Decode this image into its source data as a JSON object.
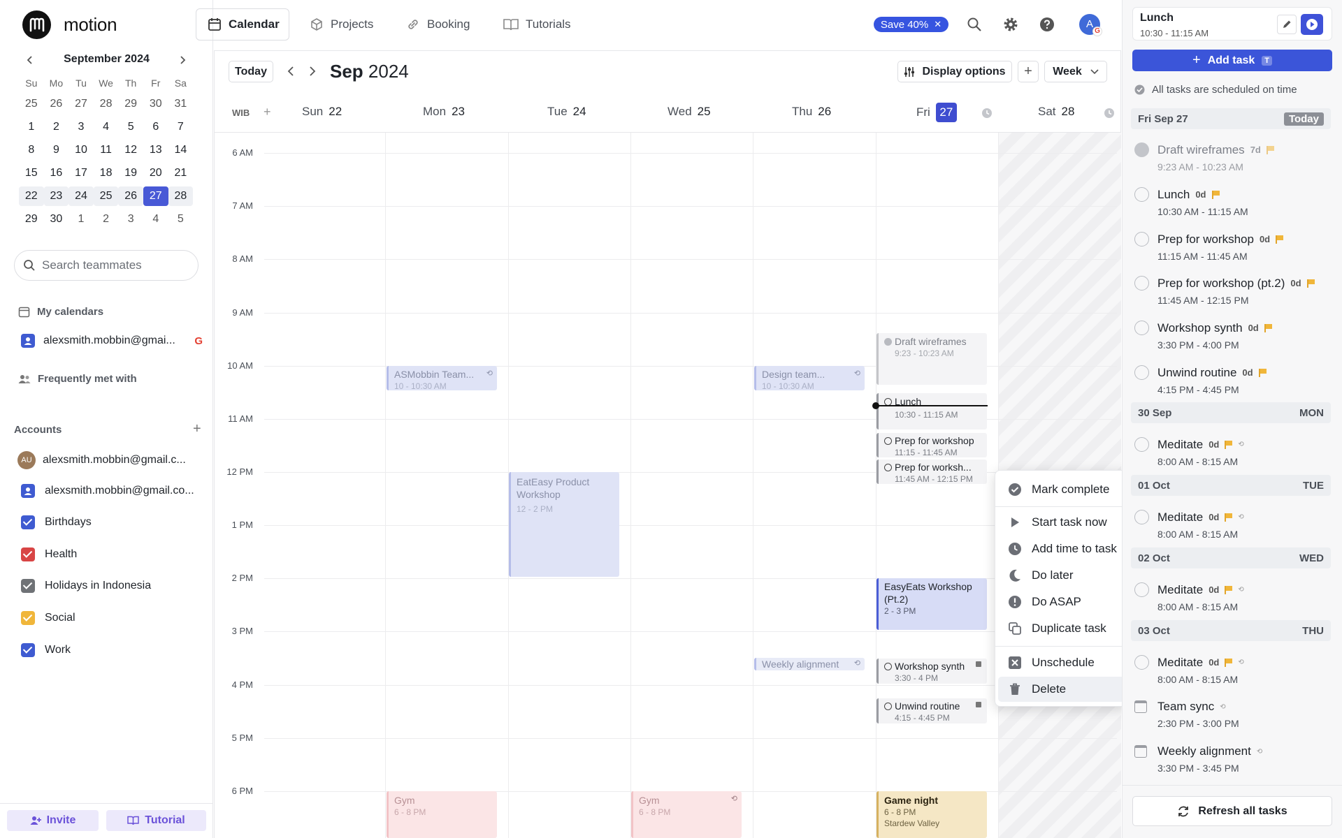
{
  "app": {
    "name": "motion"
  },
  "nav": {
    "tabs": [
      {
        "label": "Calendar"
      },
      {
        "label": "Projects"
      },
      {
        "label": "Booking"
      },
      {
        "label": "Tutorials"
      }
    ],
    "promo": "Save 40%",
    "avatar_initial": "A"
  },
  "mini_cal": {
    "title": "September 2024",
    "weekdays": [
      "Su",
      "Mo",
      "Tu",
      "We",
      "Th",
      "Fr",
      "Sa"
    ],
    "rows": [
      [
        "25",
        "26",
        "27",
        "28",
        "29",
        "30",
        "31"
      ],
      [
        "1",
        "2",
        "3",
        "4",
        "5",
        "6",
        "7"
      ],
      [
        "8",
        "9",
        "10",
        "11",
        "12",
        "13",
        "14"
      ],
      [
        "15",
        "16",
        "17",
        "18",
        "19",
        "20",
        "21"
      ],
      [
        "22",
        "23",
        "24",
        "25",
        "26",
        "27",
        "28"
      ],
      [
        "29",
        "30",
        "1",
        "2",
        "3",
        "4",
        "5"
      ]
    ],
    "selected": "27"
  },
  "sidebar": {
    "search_placeholder": "Search teammates",
    "my_calendars": "My calendars",
    "my_calendar_account": "alexsmith.mobbin@gmai...",
    "frequently_met": "Frequently met with",
    "accounts_title": "Accounts",
    "account_1": "alexsmith.mobbin@gmail.c...",
    "account_1_initials": "AU",
    "account_2": "alexsmith.mobbin@gmail.co...",
    "calendars": [
      {
        "label": "Birthdays",
        "color": "#3f5bd1"
      },
      {
        "label": "Health",
        "color": "#d84545"
      },
      {
        "label": "Holidays in Indonesia",
        "color": "#6f7276"
      },
      {
        "label": "Social",
        "color": "#f0b63a"
      },
      {
        "label": "Work",
        "color": "#3f5bd1"
      }
    ],
    "invite": "Invite",
    "tutorial": "Tutorial"
  },
  "calendar": {
    "today_button": "Today",
    "month": "Sep",
    "year": "2024",
    "display_options": "Display options",
    "view": "Week",
    "timezone": "WIB",
    "days": [
      {
        "name": "Sun",
        "num": "22"
      },
      {
        "name": "Mon",
        "num": "23"
      },
      {
        "name": "Tue",
        "num": "24"
      },
      {
        "name": "Wed",
        "num": "25"
      },
      {
        "name": "Thu",
        "num": "26"
      },
      {
        "name": "Fri",
        "num": "27"
      },
      {
        "name": "Sat",
        "num": "28"
      }
    ],
    "hours": [
      "6 AM",
      "7 AM",
      "8 AM",
      "9 AM",
      "10 AM",
      "11 AM",
      "12 PM",
      "1 PM",
      "2 PM",
      "3 PM",
      "4 PM",
      "5 PM",
      "6 PM"
    ],
    "events": {
      "asmobbin": {
        "title": "ASMobbin Team...",
        "time": "10 - 10:30 AM"
      },
      "design": {
        "title": "Design team...",
        "time": "10 - 10:30 AM"
      },
      "draft": {
        "title": "Draft wireframes",
        "time": "9:23 - 10:23 AM"
      },
      "lunch": {
        "title": "Lunch",
        "time": "10:30 - 11:15 AM"
      },
      "prep1": {
        "title": "Prep for workshop",
        "time": "11:15 - 11:45 AM"
      },
      "prep2": {
        "title": "Prep for worksh...",
        "time": "11:45 AM - 12:15 PM"
      },
      "eateasy": {
        "title": "EatEasy Product Workshop",
        "time": "12 - 2 PM"
      },
      "easyeats": {
        "title": "EasyEats Workshop (Pt.2)",
        "time": "2 - 3 PM"
      },
      "weekly": {
        "title": "Weekly alignment"
      },
      "synth": {
        "title": "Workshop synth",
        "time": "3:30 - 4 PM"
      },
      "unwind": {
        "title": "Unwind routine",
        "time": "4:15 - 4:45 PM"
      },
      "gym1": {
        "title": "Gym",
        "time": "6 - 8 PM"
      },
      "gym2": {
        "title": "Gym",
        "time": "6 - 8 PM"
      },
      "game": {
        "title": "Game night",
        "time": "6 - 8 PM",
        "location": "Stardew Valley"
      }
    }
  },
  "context_menu": {
    "items": [
      "Mark complete",
      "Start task now",
      "Add time to task",
      "Do later",
      "Do ASAP",
      "Duplicate task",
      "Unschedule",
      "Delete"
    ]
  },
  "right_panel": {
    "current_task": "Lunch",
    "current_time": "10:30 - 11:15 AM",
    "add_task": "Add task",
    "add_task_shortcut": "T",
    "status": "All tasks are scheduled on time",
    "today_header": "Fri Sep 27",
    "today_label": "Today",
    "tasks_today": [
      {
        "name": "Draft wireframes",
        "badge": "7d",
        "time": "9:23 AM - 10:23 AM"
      },
      {
        "name": "Lunch",
        "badge": "0d",
        "time": "10:30 AM - 11:15 AM"
      },
      {
        "name": "Prep for workshop",
        "badge": "0d",
        "time": "11:15 AM - 11:45 AM"
      },
      {
        "name": "Prep for workshop (pt.2)",
        "badge": "0d",
        "time": "11:45 AM - 12:15 PM"
      },
      {
        "name": "Workshop synth",
        "badge": "0d",
        "time": "3:30 PM - 4:00 PM"
      },
      {
        "name": "Unwind routine",
        "badge": "0d",
        "time": "4:15 PM - 4:45 PM"
      }
    ],
    "day_groups": [
      {
        "date": "30 Sep",
        "dow": "MON",
        "task": "Meditate",
        "badge": "0d",
        "time": "8:00 AM - 8:15 AM"
      },
      {
        "date": "01 Oct",
        "dow": "TUE",
        "task": "Meditate",
        "badge": "0d",
        "time": "8:00 AM - 8:15 AM"
      },
      {
        "date": "02 Oct",
        "dow": "WED",
        "task": "Meditate",
        "badge": "0d",
        "time": "8:00 AM - 8:15 AM"
      },
      {
        "date": "03 Oct",
        "dow": "THU",
        "task": "Meditate",
        "badge": "0d",
        "time": "8:00 AM - 8:15 AM"
      }
    ],
    "events_oct3": [
      {
        "name": "Team sync",
        "time": "2:30 PM - 3:00 PM"
      },
      {
        "name": "Weekly alignment",
        "time": "3:30 PM - 3:45 PM"
      }
    ],
    "refresh": "Refresh all tasks"
  }
}
